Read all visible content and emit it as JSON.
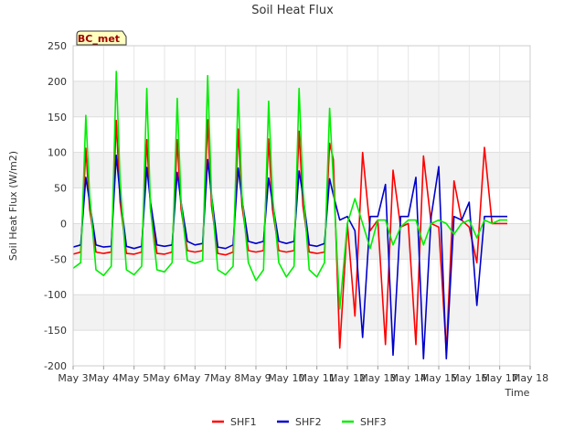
{
  "chart_data": {
    "type": "line",
    "title": "Soil Heat Flux",
    "xlabel": "Time",
    "ylabel": "Soil Heat Flux (W/m2)",
    "station_label": "BC_met",
    "xlim": [
      "2023-05-03",
      "2023-05-18"
    ],
    "ylim": [
      -200,
      250
    ],
    "yticks": [
      -200,
      -150,
      -100,
      -50,
      0,
      50,
      100,
      150,
      200,
      250
    ],
    "xtick_labels": [
      "May 3",
      "May 4",
      "May 5",
      "May 6",
      "May 7",
      "May 8",
      "May 9",
      "May 10",
      "May 11",
      "May 12",
      "May 13",
      "May 14",
      "May 15",
      "May 16",
      "May 17",
      "May 18"
    ],
    "grid": true,
    "legend_position": "bottom-center",
    "series": [
      {
        "name": "SHF1",
        "color": "#ff0000",
        "x": [
          "2023-05-03 00:00",
          "2023-05-03 06:00",
          "2023-05-03 10:00",
          "2023-05-03 13:00",
          "2023-05-03 18:00",
          "2023-05-04 00:00",
          "2023-05-04 06:00",
          "2023-05-04 10:00",
          "2023-05-04 13:00",
          "2023-05-04 18:00",
          "2023-05-05 00:00",
          "2023-05-05 06:00",
          "2023-05-05 10:00",
          "2023-05-05 13:00",
          "2023-05-05 18:00",
          "2023-05-06 00:00",
          "2023-05-06 06:00",
          "2023-05-06 10:00",
          "2023-05-06 13:00",
          "2023-05-06 18:00",
          "2023-05-07 00:00",
          "2023-05-07 06:00",
          "2023-05-07 10:00",
          "2023-05-07 13:00",
          "2023-05-07 18:00",
          "2023-05-08 00:00",
          "2023-05-08 06:00",
          "2023-05-08 10:00",
          "2023-05-08 13:00",
          "2023-05-08 18:00",
          "2023-05-09 00:00",
          "2023-05-09 06:00",
          "2023-05-09 10:00",
          "2023-05-09 13:00",
          "2023-05-09 18:00",
          "2023-05-10 00:00",
          "2023-05-10 06:00",
          "2023-05-10 10:00",
          "2023-05-10 13:00",
          "2023-05-10 18:00",
          "2023-05-11 00:00",
          "2023-05-11 06:00",
          "2023-05-11 10:00",
          "2023-05-11 13:00",
          "2023-05-11 18:00",
          "2023-05-12 00:00",
          "2023-05-12 06:00",
          "2023-05-12 12:00",
          "2023-05-12 18:00",
          "2023-05-13 00:00",
          "2023-05-13 06:00",
          "2023-05-13 12:00",
          "2023-05-13 18:00",
          "2023-05-14 00:00",
          "2023-05-14 06:00",
          "2023-05-14 12:00",
          "2023-05-14 18:00",
          "2023-05-15 00:00",
          "2023-05-15 06:00",
          "2023-05-15 12:00",
          "2023-05-15 18:00",
          "2023-05-16 00:00",
          "2023-05-16 06:00",
          "2023-05-16 12:00",
          "2023-05-16 18:00",
          "2023-05-17 00:00",
          "2023-05-17 06:00"
        ],
        "y": [
          -43,
          -40,
          106,
          20,
          -40,
          -42,
          -40,
          145,
          30,
          -42,
          -43,
          -40,
          118,
          20,
          -42,
          -43,
          -40,
          118,
          20,
          -38,
          -40,
          -38,
          146,
          25,
          -42,
          -44,
          -40,
          133,
          25,
          -38,
          -40,
          -38,
          119,
          20,
          -38,
          -40,
          -38,
          130,
          25,
          -40,
          -42,
          -40,
          113,
          90,
          -175,
          0,
          -130,
          100,
          -10,
          5,
          -170,
          75,
          -5,
          0,
          -170,
          95,
          0,
          -5,
          -180,
          60,
          5,
          -5,
          -55,
          107,
          0,
          0,
          0
        ]
      },
      {
        "name": "SHF2",
        "color": "#0000cc",
        "x": [
          "2023-05-03 00:00",
          "2023-05-03 06:00",
          "2023-05-03 10:00",
          "2023-05-03 13:00",
          "2023-05-03 18:00",
          "2023-05-04 00:00",
          "2023-05-04 06:00",
          "2023-05-04 10:00",
          "2023-05-04 13:00",
          "2023-05-04 18:00",
          "2023-05-05 00:00",
          "2023-05-05 06:00",
          "2023-05-05 10:00",
          "2023-05-05 13:00",
          "2023-05-05 18:00",
          "2023-05-06 00:00",
          "2023-05-06 06:00",
          "2023-05-06 10:00",
          "2023-05-06 13:00",
          "2023-05-06 18:00",
          "2023-05-07 00:00",
          "2023-05-07 06:00",
          "2023-05-07 10:00",
          "2023-05-07 13:00",
          "2023-05-07 18:00",
          "2023-05-08 00:00",
          "2023-05-08 06:00",
          "2023-05-08 10:00",
          "2023-05-08 13:00",
          "2023-05-08 18:00",
          "2023-05-09 00:00",
          "2023-05-09 06:00",
          "2023-05-09 10:00",
          "2023-05-09 13:00",
          "2023-05-09 18:00",
          "2023-05-10 00:00",
          "2023-05-10 06:00",
          "2023-05-10 10:00",
          "2023-05-10 13:00",
          "2023-05-10 18:00",
          "2023-05-11 00:00",
          "2023-05-11 06:00",
          "2023-05-11 10:00",
          "2023-05-11 13:00",
          "2023-05-11 18:00",
          "2023-05-12 00:00",
          "2023-05-12 06:00",
          "2023-05-12 12:00",
          "2023-05-12 18:00",
          "2023-05-13 00:00",
          "2023-05-13 06:00",
          "2023-05-13 12:00",
          "2023-05-13 18:00",
          "2023-05-14 00:00",
          "2023-05-14 06:00",
          "2023-05-14 12:00",
          "2023-05-14 18:00",
          "2023-05-15 00:00",
          "2023-05-15 06:00",
          "2023-05-15 12:00",
          "2023-05-15 18:00",
          "2023-05-16 00:00",
          "2023-05-16 06:00",
          "2023-05-16 12:00",
          "2023-05-16 18:00",
          "2023-05-17 00:00",
          "2023-05-17 06:00"
        ],
        "y": [
          -33,
          -30,
          65,
          30,
          -30,
          -33,
          -32,
          96,
          40,
          -32,
          -35,
          -32,
          79,
          30,
          -30,
          -32,
          -30,
          72,
          30,
          -25,
          -30,
          -28,
          90,
          40,
          -33,
          -35,
          -30,
          78,
          35,
          -25,
          -28,
          -25,
          64,
          30,
          -25,
          -28,
          -25,
          74,
          40,
          -30,
          -32,
          -28,
          63,
          40,
          5,
          10,
          -10,
          -160,
          10,
          10,
          55,
          -185,
          10,
          10,
          65,
          -190,
          10,
          80,
          -190,
          10,
          5,
          30,
          -115,
          10,
          10,
          10,
          10
        ]
      },
      {
        "name": "SHF3",
        "color": "#00ee00",
        "x": [
          "2023-05-03 00:00",
          "2023-05-03 06:00",
          "2023-05-03 10:00",
          "2023-05-03 13:00",
          "2023-05-03 18:00",
          "2023-05-04 00:00",
          "2023-05-04 06:00",
          "2023-05-04 10:00",
          "2023-05-04 13:00",
          "2023-05-04 18:00",
          "2023-05-05 00:00",
          "2023-05-05 06:00",
          "2023-05-05 10:00",
          "2023-05-05 13:00",
          "2023-05-05 18:00",
          "2023-05-06 00:00",
          "2023-05-06 06:00",
          "2023-05-06 10:00",
          "2023-05-06 13:00",
          "2023-05-06 18:00",
          "2023-05-07 00:00",
          "2023-05-07 06:00",
          "2023-05-07 10:00",
          "2023-05-07 13:00",
          "2023-05-07 18:00",
          "2023-05-08 00:00",
          "2023-05-08 06:00",
          "2023-05-08 10:00",
          "2023-05-08 13:00",
          "2023-05-08 18:00",
          "2023-05-09 00:00",
          "2023-05-09 06:00",
          "2023-05-09 10:00",
          "2023-05-09 13:00",
          "2023-05-09 18:00",
          "2023-05-10 00:00",
          "2023-05-10 06:00",
          "2023-05-10 10:00",
          "2023-05-10 13:00",
          "2023-05-10 18:00",
          "2023-05-11 00:00",
          "2023-05-11 06:00",
          "2023-05-11 10:00",
          "2023-05-11 13:00",
          "2023-05-11 18:00",
          "2023-05-12 00:00",
          "2023-05-12 06:00",
          "2023-05-12 12:00",
          "2023-05-12 18:00",
          "2023-05-13 00:00",
          "2023-05-13 06:00",
          "2023-05-13 12:00",
          "2023-05-13 18:00",
          "2023-05-14 00:00",
          "2023-05-14 06:00",
          "2023-05-14 12:00",
          "2023-05-14 18:00",
          "2023-05-15 00:00",
          "2023-05-15 06:00",
          "2023-05-15 12:00",
          "2023-05-15 18:00",
          "2023-05-16 00:00",
          "2023-05-16 06:00",
          "2023-05-16 12:00",
          "2023-05-16 18:00",
          "2023-05-17 00:00",
          "2023-05-17 06:00"
        ],
        "y": [
          -63,
          -55,
          152,
          40,
          -65,
          -73,
          -60,
          214,
          60,
          -65,
          -72,
          -60,
          190,
          20,
          -65,
          -68,
          -55,
          176,
          30,
          -52,
          -56,
          -52,
          208,
          40,
          -65,
          -72,
          -60,
          189,
          40,
          -55,
          -80,
          -65,
          172,
          40,
          -55,
          -75,
          -60,
          190,
          50,
          -65,
          -75,
          -55,
          162,
          60,
          -120,
          0,
          35,
          0,
          -35,
          5,
          5,
          -30,
          -5,
          5,
          5,
          -30,
          0,
          5,
          0,
          -15,
          0,
          5,
          -20,
          5,
          0,
          5,
          5
        ]
      }
    ]
  }
}
